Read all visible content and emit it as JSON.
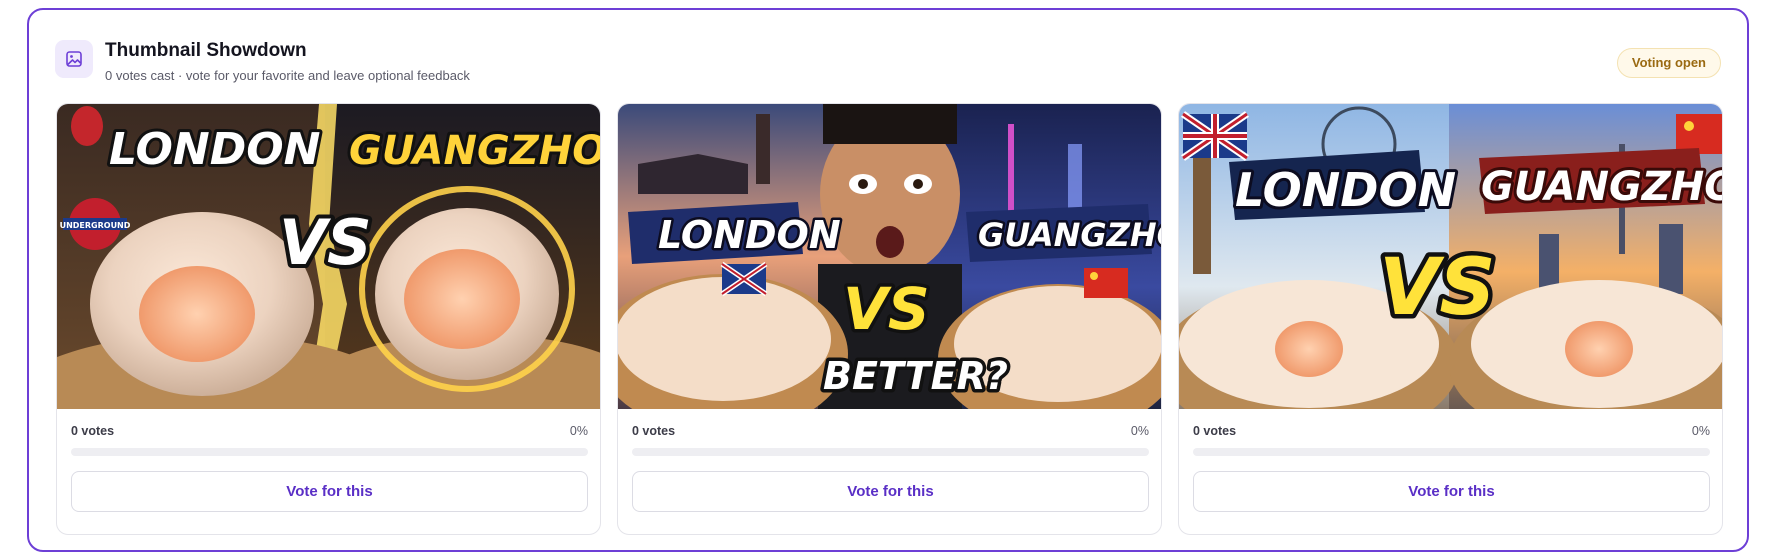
{
  "header": {
    "icon": "image-icon",
    "title": "Thumbnail Showdown",
    "subtitle": "0 votes cast · vote for your favorite and leave optional feedback",
    "status_badge": "Voting open"
  },
  "colors": {
    "accent": "#6d3fd6",
    "badge_bg": "#fff9ea",
    "badge_text": "#9a6a12"
  },
  "options": [
    {
      "overlay": {
        "left": "LONDON",
        "right": "GUANGZHOU",
        "vs": "VS",
        "sign": "UNDERGROUND"
      },
      "votes_label": "0 votes",
      "percent_label": "0%",
      "share": 0,
      "vote_button": "Vote for this"
    },
    {
      "overlay": {
        "left": "LONDON",
        "right": "GUANGZHOU",
        "vs": "VS",
        "tagline": "BETTER?"
      },
      "votes_label": "0 votes",
      "percent_label": "0%",
      "share": 0,
      "vote_button": "Vote for this"
    },
    {
      "overlay": {
        "left": "LONDON",
        "right": "GUANGZHOU",
        "vs": "VS"
      },
      "votes_label": "0 votes",
      "percent_label": "0%",
      "share": 0,
      "vote_button": "Vote for this"
    }
  ]
}
